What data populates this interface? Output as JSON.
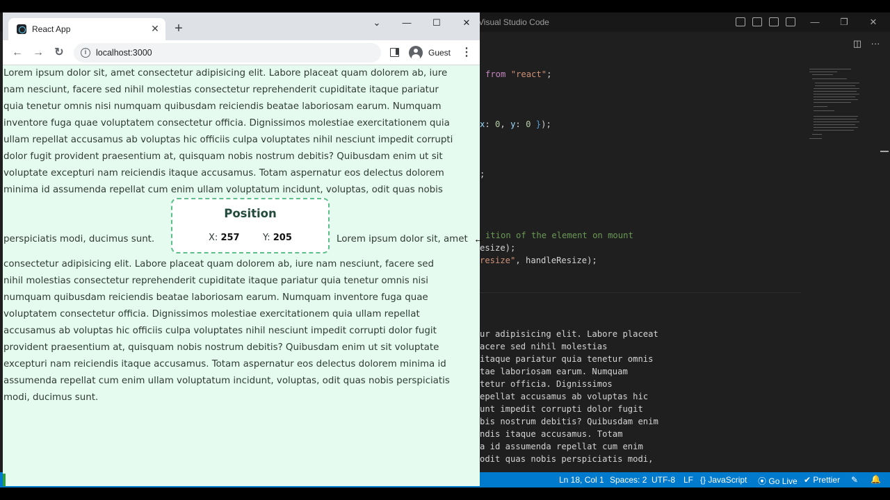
{
  "vscode": {
    "window_title": "Visual Studio Code",
    "code_lines": {
      "l1_kw": "from",
      "l1_str": "\"react\"",
      "l1_end": ";",
      "l2_a": "x",
      "l2_b": ": ",
      "l2_n1": "0",
      "l2_c": ", ",
      "l2_y": "y",
      "l2_d": ": ",
      "l2_n2": "0",
      "l2_e": " ",
      "l2_brace": "}",
      "l2_f": ");",
      "l3": ";",
      "l4_cmt": "ition of the element on mount",
      "l5": "esize);",
      "l6_str": "resize\"",
      "l6_rest": ", handleResize);",
      "t1": "ur adipisicing elit. Labore placeat",
      "t2": "acere sed nihil molestias",
      "t3": "itaque pariatur quia tenetur omnis",
      "t4": "tae laboriosam earum. Numquam",
      "t5": "tetur officia. Dignissimos",
      "t6": "epellat accusamus ab voluptas hic",
      "t7": "unt impedit corrupti dolor fugit",
      "t8": "bis nostrum debitis? Quibusdam enim",
      "t9": "ndis itaque accusamus. Totam",
      "t10": "a id assumenda repellat cum enim",
      "t11": "odit quas nobis perspiciatis modi,"
    },
    "status_bar": {
      "position": "Ln 18, Col 1",
      "spaces": "Spaces: 2",
      "encoding": "UTF-8",
      "eol": "LF",
      "language": "{} JavaScript",
      "go_live": "Go Live",
      "prettier": "Prettier"
    }
  },
  "browser": {
    "tab_title": "React App",
    "url": "localhost:3000",
    "profile_name": "Guest",
    "icons": {
      "back": "arrow-left",
      "forward": "arrow-right",
      "reload": "reload",
      "info": "info",
      "side_panel": "side-panel",
      "menu": "kebab-menu"
    }
  },
  "page": {
    "line1": "Lorem ipsum dolor sit, amet consectetur adipisicing elit. Labore placeat quam dolorem ab, iure",
    "line2": "nam nesciunt, facere sed nihil molestias consectetur reprehenderit cupiditate itaque pariatur",
    "line3": "quia tenetur omnis nisi numquam quibusdam reiciendis beatae laboriosam earum. Numquam",
    "line4": "inventore fuga quae voluptatem consectetur officia. Dignissimos molestiae exercitationem quia",
    "line5": "ullam repellat accusamus ab voluptas hic officiis culpa voluptates nihil nesciunt impedit corrupti",
    "line6": "dolor fugit provident praesentium at, quisquam nobis nostrum debitis? Quibusdam enim ut sit",
    "line7": "voluptate excepturi nam reiciendis itaque accusamus. Totam aspernatur eos delectus dolorem",
    "line8": "minima id assumenda repellat cum enim ullam voluptatum incidunt, voluptas, odit quas nobis",
    "inline_before": "perspiciatis modi, ducimus sunt.",
    "inline_after": "Lorem ipsum dolor sit, amet",
    "line9": "consectetur adipisicing elit. Labore placeat quam dolorem ab, iure nam nesciunt, facere sed",
    "line10": "nihil molestias consectetur reprehenderit cupiditate itaque pariatur quia tenetur omnis nisi",
    "line11": "numquam quibusdam reiciendis beatae laboriosam earum. Numquam inventore fuga quae",
    "line12": "voluptatem consectetur officia. Dignissimos molestiae exercitationem quia ullam repellat",
    "line13": "accusamus ab voluptas hic officiis culpa voluptates nihil nesciunt impedit corrupti dolor fugit",
    "line14": "provident praesentium at, quisquam nobis nostrum debitis? Quibusdam enim ut sit voluptate",
    "line15": "excepturi nam reiciendis itaque accusamus. Totam aspernatur eos delectus dolorem minima id",
    "line16": "assumenda repellat cum enim ullam voluptatum incidunt, voluptas, odit quas nobis perspiciatis",
    "line17": "modi, ducimus sunt.",
    "position_card": {
      "title": "Position",
      "x_label": "X:",
      "x_value": "257",
      "y_label": "Y:",
      "y_value": "205"
    }
  },
  "colors": {
    "page_background": "#e6fbef",
    "card_border": "#5bbf8a",
    "vscode_statusbar": "#007acc"
  }
}
